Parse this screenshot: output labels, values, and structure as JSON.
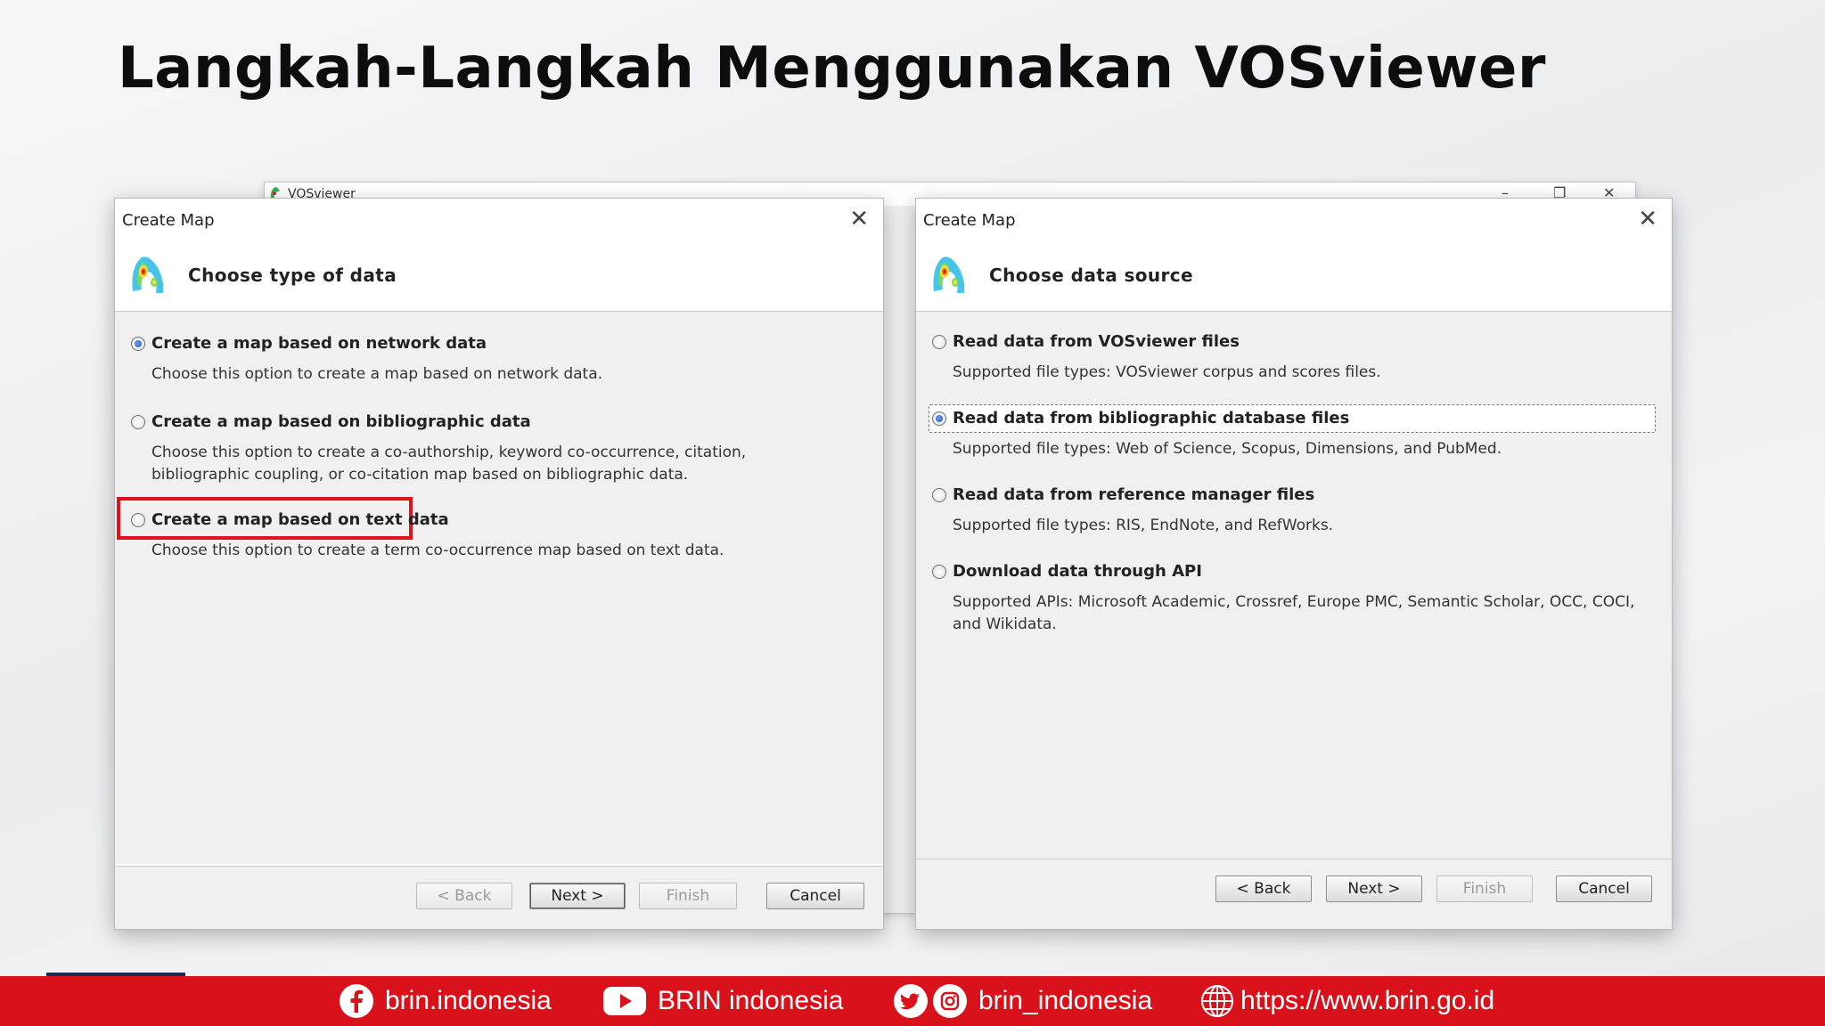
{
  "slide": {
    "title": "Langkah-Langkah Menggunakan VOSviewer"
  },
  "background_window": {
    "title": "VOSviewer",
    "minimize": "–",
    "maximize": "❐",
    "close": "✕"
  },
  "dialog_left": {
    "title": "Create Map",
    "close": "✕",
    "header": "Choose type of data",
    "options": [
      {
        "label": "Create a map based on network data",
        "desc": "Choose this option to create a map based on network data.",
        "checked": true
      },
      {
        "label": "Create a map based on bibliographic data",
        "desc": "Choose this option to create a co-authorship, keyword co-occurrence, citation, bibliographic coupling, or co-citation map based on bibliographic data.",
        "checked": false
      },
      {
        "label": "Create a map based on text data",
        "desc": "Choose this option to create a term co-occurrence map based on text data.",
        "checked": false
      }
    ],
    "buttons": {
      "back": "< Back",
      "next": "Next >",
      "finish": "Finish",
      "cancel": "Cancel"
    }
  },
  "dialog_right": {
    "title": "Create Map",
    "close": "✕",
    "header": "Choose data source",
    "options": [
      {
        "label": "Read data from VOSviewer files",
        "desc": "Supported file types: VOSviewer corpus and scores files.",
        "checked": false
      },
      {
        "label": "Read data from bibliographic database files",
        "desc": "Supported file types: Web of Science, Scopus, Dimensions, and PubMed.",
        "checked": true
      },
      {
        "label": "Read data from reference manager files",
        "desc": "Supported file types: RIS, EndNote, and RefWorks.",
        "checked": false
      },
      {
        "label": "Download data through API",
        "desc": "Supported APIs: Microsoft Academic, Crossref, Europe PMC, Semantic Scholar, OCC, COCI, and Wikidata.",
        "checked": false
      }
    ],
    "buttons": {
      "back": "< Back",
      "next": "Next >",
      "finish": "Finish",
      "cancel": "Cancel"
    }
  },
  "banner": {
    "facebook": "brin.indonesia",
    "youtube": "BRIN indonesia",
    "twitter_instagram": "brin_indonesia",
    "website": "https://www.brin.go.id"
  },
  "colors": {
    "banner": "#d9111a",
    "highlight": "#e0121b",
    "radio_selected": "#2658b5"
  }
}
